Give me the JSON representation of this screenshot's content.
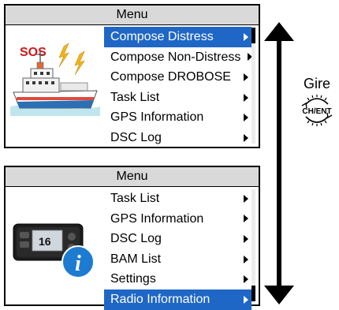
{
  "panel_top": {
    "title": "Menu",
    "items": [
      {
        "label": "Compose Distress",
        "selected": true
      },
      {
        "label": "Compose Non-Distress",
        "selected": false
      },
      {
        "label": "Compose DROBOSE",
        "selected": false
      },
      {
        "label": "Task List",
        "selected": false
      },
      {
        "label": "GPS Information",
        "selected": false
      },
      {
        "label": "DSC Log",
        "selected": false
      }
    ],
    "illustration_text": "SOS"
  },
  "panel_bottom": {
    "title": "Menu",
    "items": [
      {
        "label": "Task List",
        "selected": false
      },
      {
        "label": "GPS Information",
        "selected": false
      },
      {
        "label": "DSC Log",
        "selected": false
      },
      {
        "label": "BAM List",
        "selected": false
      },
      {
        "label": "Settings",
        "selected": false
      },
      {
        "label": "Radio Information",
        "selected": true
      }
    ],
    "device_screen_text": "16"
  },
  "side": {
    "gire_label": "Gire",
    "dial_label": "CH/ENT"
  },
  "colors": {
    "selection": "#1f67c6",
    "title_bar": "#d9d9d9",
    "sos_red": "#d01818",
    "info_blue": "#1d7bd2"
  }
}
